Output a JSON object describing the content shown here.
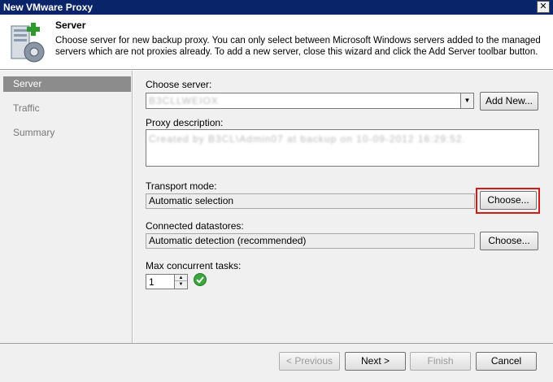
{
  "window": {
    "title": "New VMware Proxy",
    "close_glyph": "✕"
  },
  "header": {
    "title": "Server",
    "description": "Choose server for new backup proxy. You can only select between Microsoft Windows servers added to the managed servers which are not proxies already. To add a new server, close this wizard and click the Add Server toolbar button.",
    "icon": "server-gear-add-icon"
  },
  "sidebar": {
    "items": [
      {
        "label": "Server",
        "active": true
      },
      {
        "label": "Traffic",
        "active": false
      },
      {
        "label": "Summary",
        "active": false
      }
    ]
  },
  "form": {
    "choose_server_label": "Choose server:",
    "server_value": "B3CLLWEIOX",
    "add_new_label": "Add New...",
    "proxy_description_label": "Proxy description:",
    "proxy_description_value": "Created by B3CL\\Admin07 at backup on 10-09-2012 16:29:52.",
    "transport_mode_label": "Transport mode:",
    "transport_mode_value": "Automatic selection",
    "transport_choose_label": "Choose...",
    "connected_datastores_label": "Connected datastores:",
    "datastores_value": "Automatic detection (recommended)",
    "datastores_choose_label": "Choose...",
    "max_tasks_label": "Max concurrent tasks:",
    "max_tasks_value": "1"
  },
  "footer": {
    "previous_label": "< Previous",
    "next_label": "Next >",
    "finish_label": "Finish",
    "cancel_label": "Cancel"
  },
  "colors": {
    "titlebar": "#0a246a",
    "highlight": "#d11a1a",
    "sidebar_active": "#8c8c8c"
  }
}
